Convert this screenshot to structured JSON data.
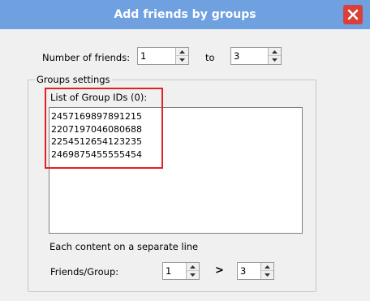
{
  "window": {
    "title": "Add friends by groups",
    "close_icon": "close-icon",
    "title_bar_color": "#6fa0e0",
    "close_color": "#d9403a"
  },
  "number_of_friends": {
    "label": "Number of friends:",
    "from_value": "1",
    "to_label": "to",
    "to_value": "3"
  },
  "groups_settings": {
    "legend": "Groups settings",
    "list_label": "List of Group IDs (0):",
    "group_ids": [
      "2457169897891215",
      "2207197046080688",
      "2254512654123235",
      "2469875455555454"
    ],
    "hint": "Each content on a separate line",
    "friends_per_group_label": "Friends/Group:",
    "friends_per_group_min": "1",
    "separator": ">",
    "friends_per_group_max": "3"
  },
  "highlight_color": "#e41f26"
}
